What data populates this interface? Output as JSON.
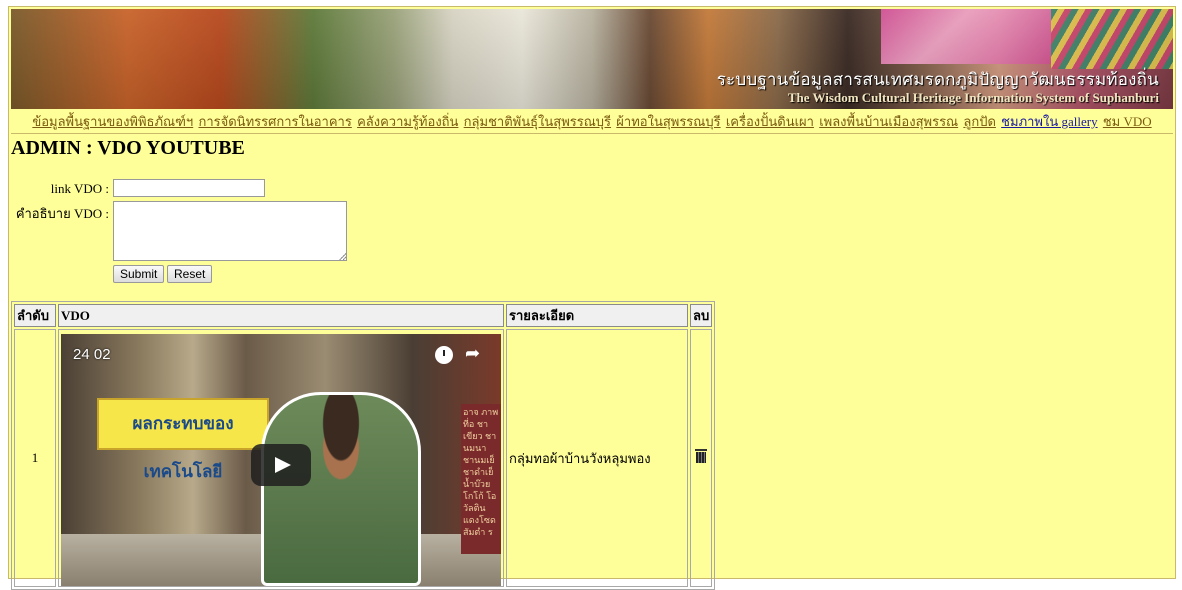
{
  "banner": {
    "title_th": "ระบบฐานข้อมูลสารสนเทศมรดกภูมิปัญญาวัฒนธรรมท้องถิ่น",
    "title_en": "The Wisdom Cultural Heritage Information System of Suphanburi"
  },
  "nav": {
    "items": [
      "ข้อมูลพื้นฐานของพิพิธภัณฑ์ฯ",
      "การจัดนิทรรศการในอาคาร",
      "คลังความรู้ท้องถิ่น",
      "กลุ่มชาติพันธุ์ในสุพรรณบุรี",
      "ผ้าทอในสุพรรณบุรี",
      "เครื่องปั้นดินเผา",
      "เพลงพื้นบ้านเมืองสุพรรณ",
      "ลูกปัด",
      "ชมภาพใน gallery",
      "ชม VDO"
    ]
  },
  "page_title": "ADMIN : VDO YOUTUBE",
  "form": {
    "link_label": "link VDO :",
    "desc_label": "คำอธิบาย VDO :",
    "link_value": "",
    "desc_value": "",
    "submit_label": "Submit",
    "reset_label": "Reset"
  },
  "table": {
    "headers": [
      "ลำดับ",
      "VDO",
      "รายละเอียด",
      "ลบ"
    ],
    "rows": [
      {
        "index": "1",
        "video_time": "24 02",
        "sign_text": "ผลกระทบของเทคโนโลยี",
        "poster_text": "อาจ ภาพที่อ ชาเขียว ชานมนา ชานมเย็ ชาดำเย็ น้ำบ๊วย โกโก้ โอวัลติน แดงโซด สัมตำ ร",
        "detail": "กลุ่มทอผ้าบ้านวังหลุมพอง"
      }
    ]
  }
}
